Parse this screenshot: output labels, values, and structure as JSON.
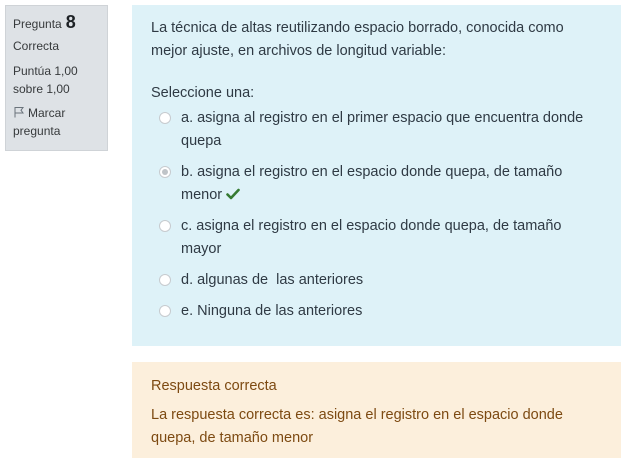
{
  "info": {
    "question_label": "Pregunta",
    "question_number": "8",
    "state": "Correcta",
    "grade": "Puntúa 1,00 sobre 1,00",
    "flag_label": "Marcar pregunta"
  },
  "question": {
    "text": "La técnica de altas reutilizando espacio borrado, conocida como mejor ajuste,  en archivos de longitud variable:",
    "prompt": "Seleccione una:",
    "options": [
      {
        "label": "a. asigna al registro en el primer espacio que encuentra donde quepa",
        "selected": false
      },
      {
        "label": "b. asigna el registro en el espacio donde quepa, de tamaño menor",
        "selected": true
      },
      {
        "label": "c. asigna el registro en el espacio donde quepa, de tamaño mayor",
        "selected": false
      },
      {
        "label": "d. algunas de  las anteriores",
        "selected": false
      },
      {
        "label": "e. Ninguna de las anteriores",
        "selected": false
      }
    ]
  },
  "feedback": {
    "title": "Respuesta correcta",
    "correct_answer": "La respuesta correcta es: asigna el registro en el espacio donde quepa, de tamaño menor"
  },
  "colors": {
    "info_bg": "#dee2e6",
    "question_bg": "#def2f8",
    "feedback_bg": "#fcefdc",
    "feedback_text": "#7d4a12",
    "correct_check": "#357a32"
  },
  "icons": {
    "flag": "flag-icon",
    "correct": "check-icon"
  }
}
